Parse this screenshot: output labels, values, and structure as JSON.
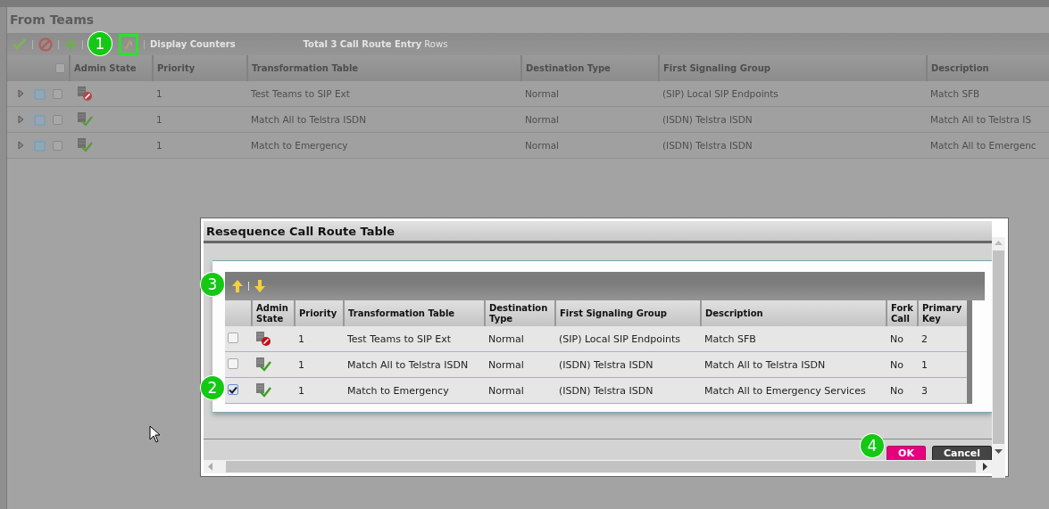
{
  "page": {
    "title": "From Teams"
  },
  "toolbar": {
    "display_counters": "Display Counters",
    "total": "**Total 3 Call Route Entry** Rows"
  },
  "table": {
    "all_checked": false,
    "admin_state_header": "Admin State",
    "columns": [
      "Priority",
      "Transformation Table",
      "Destination Type",
      "First Signaling Group",
      "Description"
    ],
    "rows": [
      {
        "checked": false,
        "enabled": false,
        "cells": [
          "1",
          "Test Teams to SIP Ext",
          "Normal",
          "(SIP) Local SIP Endpoints",
          "Match SFB"
        ]
      },
      {
        "checked": false,
        "enabled": true,
        "cells": [
          "1",
          "Match All to Telstra ISDN",
          "Normal",
          "(ISDN) Telstra ISDN",
          "Match All to Telstra IS"
        ]
      },
      {
        "checked": false,
        "enabled": true,
        "cells": [
          "1",
          "Match to Emergency",
          "Normal",
          "(ISDN) Telstra ISDN",
          "Match All to Emergenc"
        ]
      }
    ]
  },
  "dialog": {
    "title": "Resequence Call Route Table",
    "admin_state_header": "Admin State",
    "columns": [
      "Priority",
      "Transformation Table",
      "Destination Type",
      "First Signaling Group",
      "Description",
      "Fork Call",
      "Primary Key"
    ],
    "rows": [
      {
        "checked": false,
        "enabled": false,
        "cells": [
          "1",
          "Test Teams to SIP Ext",
          "Normal",
          "(SIP) Local SIP Endpoints",
          "Match SFB",
          "No",
          "2"
        ]
      },
      {
        "checked": false,
        "enabled": true,
        "cells": [
          "1",
          "Match All to Telstra ISDN",
          "Normal",
          "(ISDN) Telstra ISDN",
          "Match All to Telstra ISDN",
          "No",
          "1"
        ]
      },
      {
        "checked": true,
        "enabled": true,
        "cells": [
          "1",
          "Match to Emergency",
          "Normal",
          "(ISDN) Telstra ISDN",
          "Match All to Emergency Services",
          "No",
          "3"
        ]
      }
    ],
    "buttons": [
      {
        "label": "OK",
        "kind": "primary"
      },
      {
        "label": "Cancel",
        "kind": "secondary"
      }
    ]
  },
  "annotations": [
    "1",
    "2",
    "3",
    "4"
  ]
}
